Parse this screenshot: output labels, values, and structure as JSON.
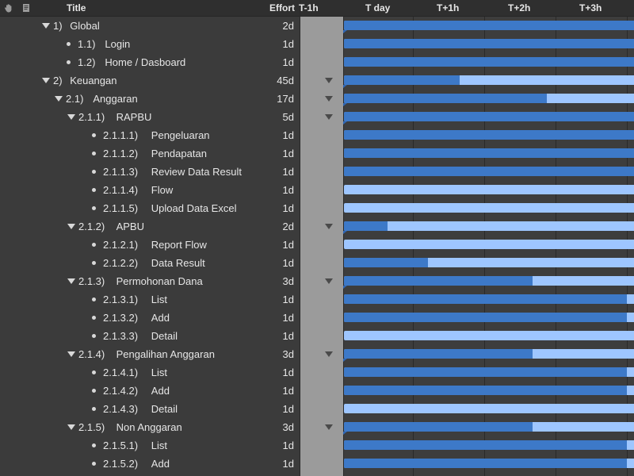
{
  "header": {
    "title": "Title",
    "effort": "Effort",
    "mid_col": "T-1h",
    "cols": [
      "T day",
      "T+1h",
      "T+2h",
      "T+3h"
    ]
  },
  "colors": {
    "done_bar": "#3d79c8",
    "remaining_bar": "#9ec6ff",
    "pane_bg": "#3b3b3b",
    "strip_bg": "#9b9b9b"
  },
  "rows": [
    {
      "num": "1)",
      "name": "Global",
      "effort": "2d",
      "level": 0,
      "group": true,
      "progress": 1.0,
      "tick": true
    },
    {
      "num": "1.1)",
      "name": "Login",
      "effort": "1d",
      "level": 1,
      "group": false,
      "progress": 1.0
    },
    {
      "num": "1.2)",
      "name": "Home / Dasboard",
      "effort": "1d",
      "level": 1,
      "group": false,
      "progress": 1.0
    },
    {
      "num": "2)",
      "name": "Keuangan",
      "effort": "45d",
      "level": 0,
      "group": true,
      "progress": 0.4,
      "tick": true
    },
    {
      "num": "2.1)",
      "name": "Anggaran",
      "effort": "17d",
      "level": 1,
      "group": true,
      "progress": 0.7,
      "tick": true
    },
    {
      "num": "2.1.1)",
      "name": "RAPBU",
      "effort": "5d",
      "level": 2,
      "group": true,
      "progress": 1.0,
      "tick": true
    },
    {
      "num": "2.1.1.1)",
      "name": "Pengeluaran",
      "effort": "1d",
      "level": 3,
      "group": false,
      "progress": 1.0
    },
    {
      "num": "2.1.1.2)",
      "name": "Pendapatan",
      "effort": "1d",
      "level": 3,
      "group": false,
      "progress": 1.0
    },
    {
      "num": "2.1.1.3)",
      "name": "Review Data Result",
      "effort": "1d",
      "level": 3,
      "group": false,
      "progress": 1.0
    },
    {
      "num": "2.1.1.4)",
      "name": "Flow",
      "effort": "1d",
      "level": 3,
      "group": false,
      "progress": 0.0
    },
    {
      "num": "2.1.1.5)",
      "name": "Upload Data Excel",
      "effort": "1d",
      "level": 3,
      "group": false,
      "progress": 0.0
    },
    {
      "num": "2.1.2)",
      "name": "APBU",
      "effort": "2d",
      "level": 2,
      "group": true,
      "progress": 0.15,
      "tick": true
    },
    {
      "num": "2.1.2.1)",
      "name": "Report Flow",
      "effort": "1d",
      "level": 3,
      "group": false,
      "progress": 0.0
    },
    {
      "num": "2.1.2.2)",
      "name": "Data Result",
      "effort": "1d",
      "level": 3,
      "group": false,
      "progress": 0.29
    },
    {
      "num": "2.1.3)",
      "name": "Permohonan Dana",
      "effort": "3d",
      "level": 2,
      "group": true,
      "progress": 0.65,
      "tick": true
    },
    {
      "num": "2.1.3.1)",
      "name": "List",
      "effort": "1d",
      "level": 3,
      "group": false,
      "progress": 0.975
    },
    {
      "num": "2.1.3.2)",
      "name": "Add",
      "effort": "1d",
      "level": 3,
      "group": false,
      "progress": 0.975
    },
    {
      "num": "2.1.3.3)",
      "name": "Detail",
      "effort": "1d",
      "level": 3,
      "group": false,
      "progress": 0.0
    },
    {
      "num": "2.1.4)",
      "name": "Pengalihan Anggaran",
      "effort": "3d",
      "level": 2,
      "group": true,
      "progress": 0.65,
      "tick": true
    },
    {
      "num": "2.1.4.1)",
      "name": "List",
      "effort": "1d",
      "level": 3,
      "group": false,
      "progress": 0.975
    },
    {
      "num": "2.1.4.2)",
      "name": "Add",
      "effort": "1d",
      "level": 3,
      "group": false,
      "progress": 0.975
    },
    {
      "num": "2.1.4.3)",
      "name": "Detail",
      "effort": "1d",
      "level": 3,
      "group": false,
      "progress": 0.0
    },
    {
      "num": "2.1.5)",
      "name": "Non Anggaran",
      "effort": "3d",
      "level": 2,
      "group": true,
      "progress": 0.65,
      "tick": true
    },
    {
      "num": "2.1.5.1)",
      "name": "List",
      "effort": "1d",
      "level": 3,
      "group": false,
      "progress": 0.975
    },
    {
      "num": "2.1.5.2)",
      "name": "Add",
      "effort": "1d",
      "level": 3,
      "group": false,
      "progress": 0.975
    }
  ]
}
